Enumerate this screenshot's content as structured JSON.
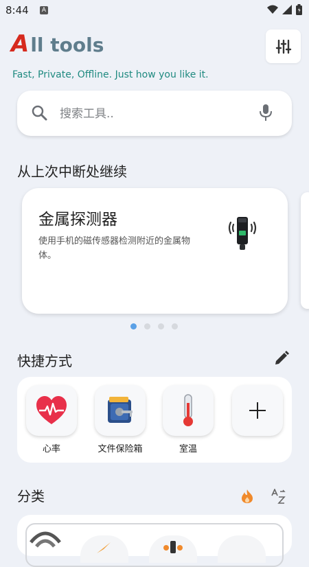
{
  "status_bar": {
    "time": "8:44",
    "notification_icon": "A"
  },
  "header": {
    "logo_letter": "A",
    "logo_rest": "ll tools",
    "tagline": "Fast, Private, Offline. Just how you like it.",
    "settings_icon": "sliders-icon"
  },
  "search": {
    "placeholder": "搜索工具..",
    "value": ""
  },
  "continue": {
    "title": "从上次中断处继续",
    "card": {
      "title": "金属探测器",
      "description": "使用手机的磁传感器检测附近的金属物体。",
      "icon": "metal-detector-icon"
    },
    "pager": {
      "count": 4,
      "active_index": 0
    }
  },
  "shortcuts": {
    "title": "快捷方式",
    "items": [
      {
        "label": "心率",
        "icon": "heart-rate-icon"
      },
      {
        "label": "文件保险箱",
        "icon": "file-vault-icon"
      },
      {
        "label": "室温",
        "icon": "thermometer-icon"
      },
      {
        "label": "",
        "icon": "add-icon"
      }
    ]
  },
  "categories": {
    "title": "分类",
    "sort_popular_icon": "flame-icon",
    "sort_alpha_icon": "sort-az-icon"
  },
  "colors": {
    "accent_teal": "#1f8a80",
    "logo_red": "#d62a1e",
    "pager_active": "#5aa0e6",
    "background": "#eef1f7"
  }
}
